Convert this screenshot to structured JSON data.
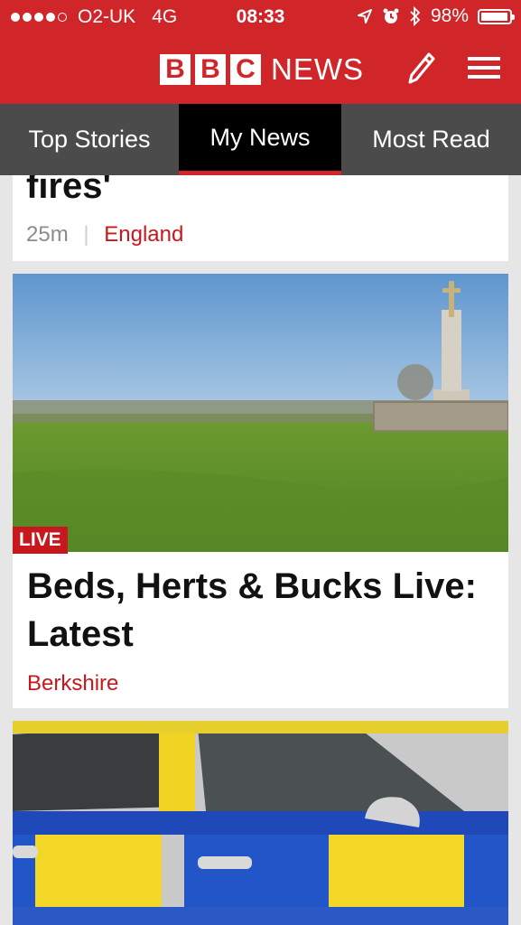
{
  "status_bar": {
    "carrier": "O2-UK",
    "network": "4G",
    "time": "08:33",
    "battery": "98%",
    "battery_level": 0.98,
    "icons": [
      "location-arrow-icon",
      "alarm-icon",
      "bluetooth-icon",
      "battery-icon"
    ]
  },
  "header": {
    "brand_letters": [
      "B",
      "B",
      "C"
    ],
    "brand_word": "NEWS",
    "icons": [
      "edit-pencil-icon",
      "hamburger-menu-icon"
    ],
    "accent_color": "#d0262a"
  },
  "tabs": [
    {
      "label": "Top Stories"
    },
    {
      "label": "My News",
      "selected": true
    },
    {
      "label": "Most Read"
    }
  ],
  "stories": [
    {
      "title": "fires'",
      "age": "25m",
      "separator": "|",
      "tag": "England"
    },
    {
      "badge": "LIVE",
      "title": "Beds, Herts & Bucks Live: Latest",
      "tag": "Berkshire",
      "image": "field-with-war-memorial"
    },
    {
      "image": "police-car-door"
    }
  ]
}
